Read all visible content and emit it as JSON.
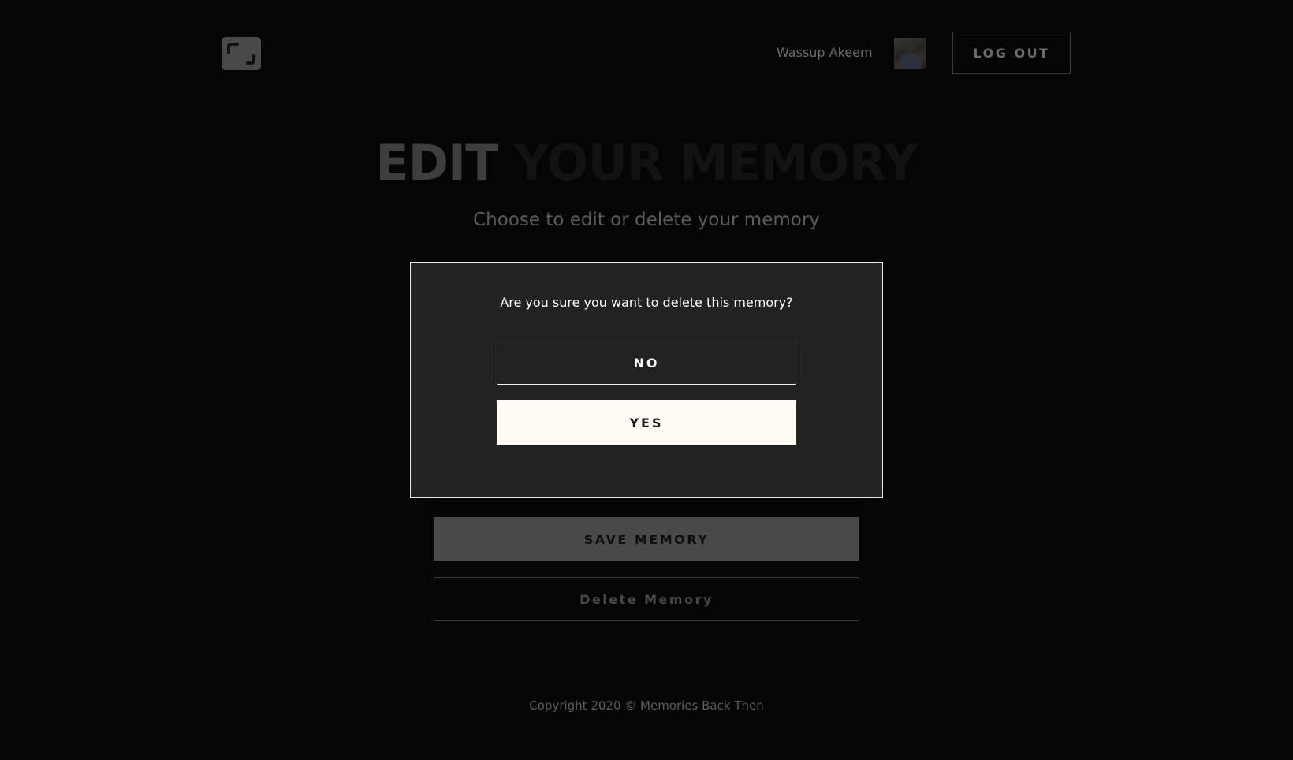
{
  "header": {
    "logo_icon": "app-logo-icon",
    "greeting": "Wassup Akeem",
    "avatar_icon": "user-avatar",
    "logout_label": "LOG OUT"
  },
  "main": {
    "title_part1": "EDIT",
    "title_part2": "YOUR MEMORY",
    "subtitle": "Choose to edit or delete your memory",
    "save_label": "SAVE MEMORY",
    "delete_label": "Delete Memory"
  },
  "modal": {
    "message": "Are you sure you want to delete this memory?",
    "no_label": "NO",
    "yes_label": "YES"
  },
  "footer": {
    "copyright": "Copyright 2020 © Memories Back Then"
  },
  "colors": {
    "background": "#050505",
    "modal_background": "#222222",
    "yes_button": "#fffaf3",
    "save_button": "#4a4946"
  }
}
